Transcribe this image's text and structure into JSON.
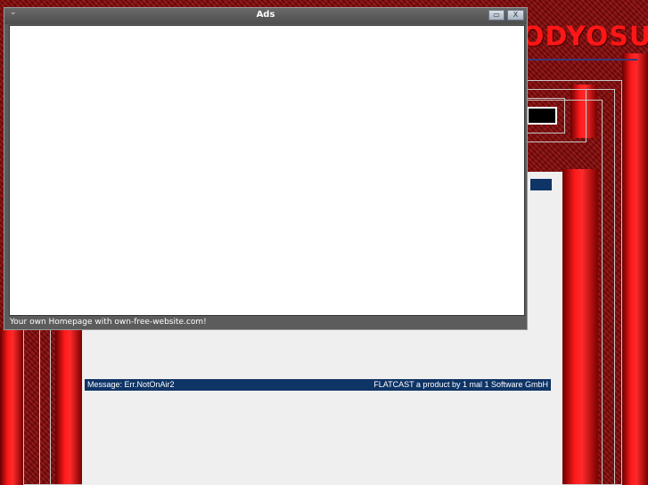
{
  "site": {
    "brand_text": "ODYOSU"
  },
  "dialog": {
    "title": "Ads",
    "minimize_glyph": "▭",
    "close_glyph": "X",
    "footer_text": "Your own Homepage with own-free-website.com!"
  },
  "player": {
    "status_message": "Message: Err.NotOnAir2",
    "credit": "FLATCAST a product by 1 mal 1 Software GmbH"
  },
  "colors": {
    "background": "#8a0c0c",
    "accent_red": "#ff1a1a",
    "status_bar": "#0f3466",
    "content_bg": "#efefef"
  }
}
